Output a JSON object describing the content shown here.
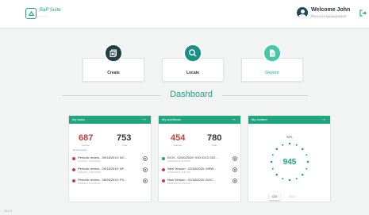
{
  "header": {
    "app_name": "BaP Suite",
    "app_sub": "———",
    "welcome": "Welcome John",
    "role": "PROCESS MANAGEMENT",
    "accent": "#1fa37a"
  },
  "actions": [
    {
      "label": "Create",
      "icon": "document-stack-icon",
      "color": "#1f3e46"
    },
    {
      "label": "Locate",
      "icon": "search-icon",
      "color": "#1a8f86"
    },
    {
      "label": "Govern",
      "icon": "document-icon",
      "color": "#45c9a5"
    }
  ],
  "dashboard": {
    "title": "Dashboard"
  },
  "tasks": {
    "title": "My tasks",
    "count_a": "687",
    "count_a_label": "overdue",
    "count_b": "753",
    "count_b_label": "Total",
    "recent_label": "Recent tasks",
    "items": [
      {
        "title": "Periodic review - 09/18/2019: NC...",
        "date": "10/11/2017 11:50:08 EDT",
        "color": "#d23c3c"
      },
      {
        "title": "Periodic review - 09/18/2019: NF...",
        "date": "10/11/2017 10:08:08 EDT",
        "color": "#d23c3c"
      },
      {
        "title": "Periodic review - 08/26/2019: PX...",
        "date": "02/18/2019 10:10:30 EDT",
        "color": "#d23c3c"
      }
    ]
  },
  "workflows": {
    "title": "My workflows",
    "count_a": "454",
    "count_a_label": "overdue",
    "count_b": "780",
    "count_b_label": "Total",
    "recent_label": "Recent tasks",
    "items": [
      {
        "title": "DCO - 02/20/2020: XXX DCO 202...",
        "date": "02/20/2020 10:48:29 EST",
        "color": "#1fa37a"
      },
      {
        "title": "New Version - 02/18/2020: MRW...",
        "date": "02/18/2020 11:04:51 EST",
        "color": "#d23c3c"
      },
      {
        "title": "New Version - 02/18/2020: DOC...",
        "date": "02/18/2020 11:11:53 EST",
        "color": "#d23c3c"
      }
    ]
  },
  "content": {
    "title": "My content",
    "donut_label": "IMPL",
    "donut_value": "945",
    "tabs": [
      "CDI",
      "DCD"
    ]
  },
  "footer": {
    "version": "10.1.0"
  }
}
